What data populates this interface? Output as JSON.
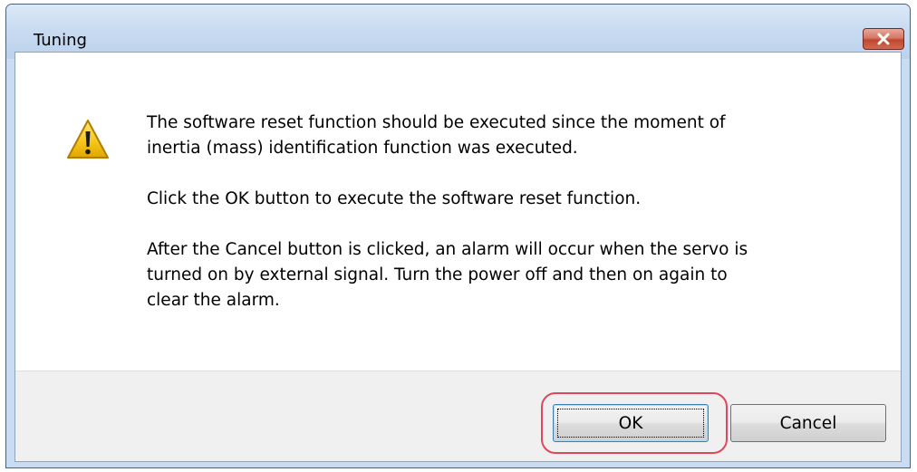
{
  "window": {
    "title": "Tuning"
  },
  "close_button": {
    "icon": "close-icon"
  },
  "message": {
    "icon": "warning-icon",
    "paragraph1_line1": "The software reset function should be executed since the moment of",
    "paragraph1_line2": "inertia (mass) identification function was executed.",
    "paragraph2": "Click the OK button to execute the software reset function.",
    "paragraph3_line1": "After the Cancel button is clicked, an alarm will occur when the servo is",
    "paragraph3_line2": "turned on by external signal. Turn the power off and then on again to",
    "paragraph3_line3": "clear the alarm."
  },
  "buttons": {
    "ok_label": "OK",
    "cancel_label": "Cancel"
  },
  "colors": {
    "highlight": "#e0475b",
    "close_button": "#c0452f",
    "warning_fill": "#f5c518"
  }
}
